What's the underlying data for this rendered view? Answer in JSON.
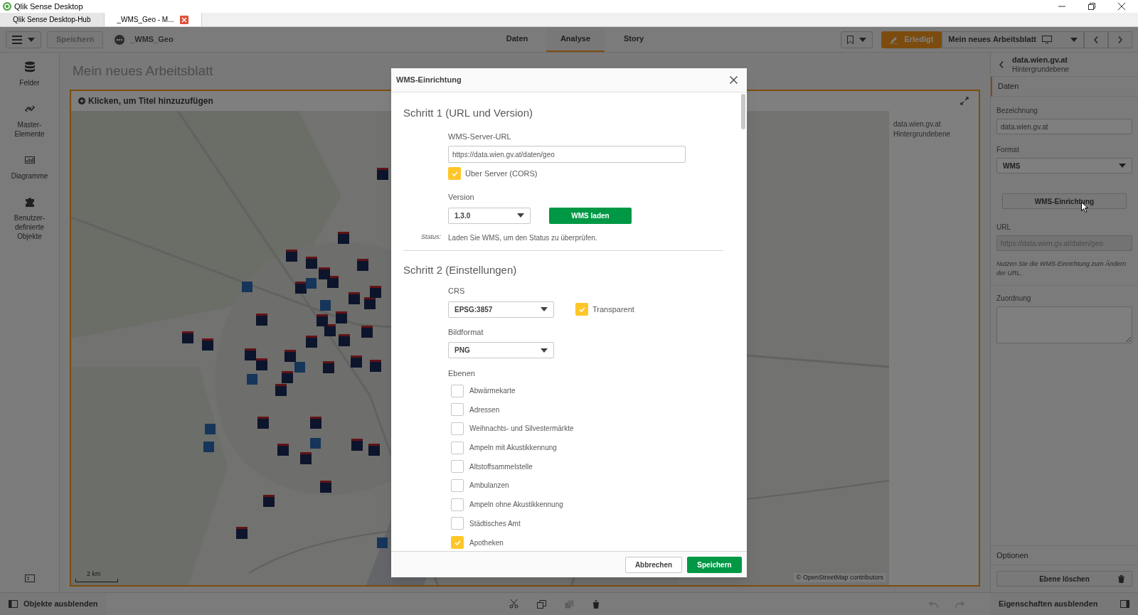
{
  "window": {
    "title": "Qlik Sense Desktop"
  },
  "browser_tabs": [
    {
      "label": "Qlik Sense Desktop-Hub",
      "selected": false,
      "closable": false
    },
    {
      "label": "_WMS_Geo - M...",
      "selected": true,
      "closable": true
    }
  ],
  "toolbar": {
    "save": "Speichern",
    "app_name": "_WMS_Geo",
    "nav_tabs": [
      {
        "label": "Daten",
        "selected": false
      },
      {
        "label": "Analyse",
        "selected": true
      },
      {
        "label": "Story",
        "selected": false
      }
    ],
    "done": "Erledigt",
    "sheet_name": "Mein neues Arbeitsblatt"
  },
  "assets": [
    {
      "label": "Felder",
      "kind": "fields"
    },
    {
      "label": "Master-Elemente",
      "kind": "master"
    },
    {
      "label": "Diagramme",
      "kind": "charts"
    },
    {
      "label": "Benutzer-definierte Objekte",
      "kind": "custom"
    }
  ],
  "sheet_title": "Mein neues Arbeitsblatt",
  "map_object": {
    "title_placeholder": "Klicken, um Titel hinzuzufügen",
    "scale": "2 km",
    "attribution": "© OpenStreetMap contributors",
    "legend_title": "data.wien.gv.at",
    "legend_subtitle": "Hintergrundebene"
  },
  "properties": {
    "title": "data.wien.gv.at",
    "subtitle": "Hintergrundebene",
    "section": "Daten",
    "name_label": "Bezeichnung",
    "name_value": "data.wien.gv.at",
    "format_label": "Format",
    "format_value": "WMS",
    "setup_button": "WMS-Einrichtung",
    "url_label": "URL",
    "url_value": "https://data.wien.gv.at/daten/geo",
    "url_hint": "Nutzen Sie die WMS-Einrichtung zum Ändern der URL.",
    "mapping_label": "Zuordnung",
    "options": "Optionen",
    "delete_button": "Ebene löschen"
  },
  "bottom_bar": {
    "hide_assets": "Objekte ausblenden",
    "hide_properties": "Eigenschaften ausblenden"
  },
  "dialog": {
    "title": "WMS-Einrichtung",
    "step1": {
      "heading": "Schritt 1 (URL und Version)",
      "url_label": "WMS-Server-URL",
      "url": "https://data.wien.gv.at/daten/geo",
      "cors": {
        "label": "Über Server (CORS)",
        "checked": true
      },
      "version_label": "Version",
      "version": "1.3.0",
      "load_button": "WMS laden",
      "status_label": "Status:",
      "status": "Laden Sie WMS, um den Status zu überprüfen."
    },
    "step2": {
      "heading": "Schritt 2 (Einstellungen)",
      "crs_label": "CRS",
      "crs": "EPSG:3857",
      "transparent": {
        "label": "Transparent",
        "checked": true
      },
      "format_label": "Bildformat",
      "format": "PNG",
      "layers_label": "Ebenen",
      "layers": [
        {
          "label": "Abwärmekarte",
          "checked": false
        },
        {
          "label": "Adressen",
          "checked": false
        },
        {
          "label": "Weihnachts- und Silvestermärkte",
          "checked": false
        },
        {
          "label": "Ampeln mit Akustikkennung",
          "checked": false
        },
        {
          "label": "Altstoffsammelstelle",
          "checked": false
        },
        {
          "label": "Ambulanzen",
          "checked": false
        },
        {
          "label": "Ampeln ohne Akustikkennung",
          "checked": false
        },
        {
          "label": "Städtisches Amt",
          "checked": false
        },
        {
          "label": "Apotheken",
          "checked": true
        }
      ]
    },
    "cancel": "Abbrechen",
    "save": "Speichern"
  }
}
